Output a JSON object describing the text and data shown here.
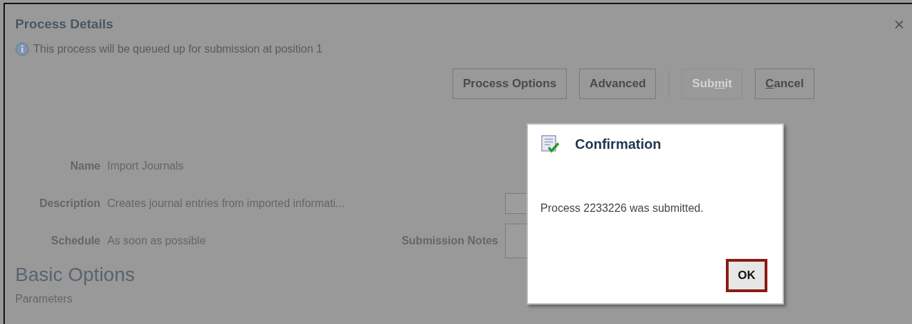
{
  "window": {
    "title": "Process Details",
    "close": "×"
  },
  "info": {
    "text": "This process will be queued up for submission at position 1"
  },
  "buttons": [
    {
      "label": [
        {
          "text": "Process Options",
          "underlined": false
        }
      ],
      "disabled": false
    },
    {
      "label": [
        {
          "text": "Advanced",
          "underlined": false
        }
      ],
      "disabled": false
    },
    {
      "label": [
        {
          "text": "Sub",
          "underlined": false
        },
        {
          "text": "m",
          "underlined": true
        },
        {
          "text": "it",
          "underlined": false
        }
      ],
      "disabled": true
    },
    {
      "label": [
        {
          "text": "C",
          "underlined": true
        },
        {
          "text": "ancel",
          "underlined": false
        }
      ],
      "disabled": false
    }
  ],
  "fields": [
    {
      "label": "Name",
      "value": "Import Journals"
    },
    {
      "label": "Description",
      "value": "Creates journal entries from imported informati..."
    },
    {
      "label": "Schedule",
      "value": "As soon as possible"
    }
  ],
  "submission_notes": {
    "label": "Submission Notes"
  },
  "section": {
    "title": "Basic Options",
    "subtitle": "Parameters"
  },
  "dialog": {
    "title": "Confirmation",
    "message": "Process 2233226 was submitted.",
    "ok": {
      "label": "OK",
      "highlighted": true
    }
  }
}
